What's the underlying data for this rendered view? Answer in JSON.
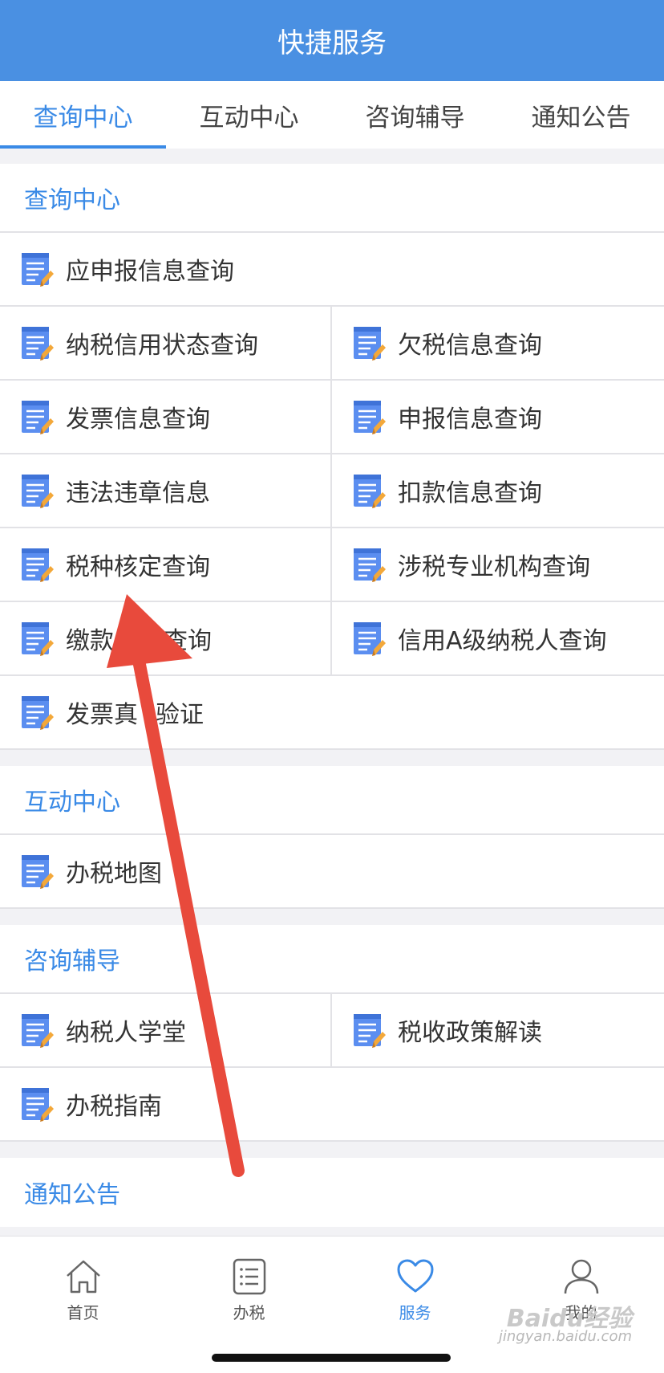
{
  "header": {
    "title": "快捷服务"
  },
  "tabs": [
    {
      "label": "查询中心",
      "active": true
    },
    {
      "label": "互动中心",
      "active": false
    },
    {
      "label": "咨询辅导",
      "active": false
    },
    {
      "label": "通知公告",
      "active": false
    }
  ],
  "sections": {
    "query": {
      "title": "查询中心",
      "items": [
        "应申报信息查询",
        "纳税信用状态查询",
        "欠税信息查询",
        "发票信息查询",
        "申报信息查询",
        "违法违章信息",
        "扣款信息查询",
        "税种核定查询",
        "涉税专业机构查询",
        "缴款",
        "查询",
        "信用A级纳税人查询",
        "发票真",
        "验证"
      ]
    },
    "interact": {
      "title": "互动中心",
      "items": [
        "办税地图"
      ]
    },
    "consult": {
      "title": "咨询辅导",
      "items": [
        "纳税人学堂",
        "税收政策解读",
        "办税指南"
      ]
    },
    "notice": {
      "title": "通知公告"
    }
  },
  "bottom_nav": [
    {
      "label": "首页",
      "icon": "home-icon"
    },
    {
      "label": "办税",
      "icon": "list-icon"
    },
    {
      "label": "服务",
      "icon": "heart-icon",
      "active": true
    },
    {
      "label": "我的",
      "icon": "user-icon"
    }
  ],
  "icons": {
    "item_icon": "document-pencil-icon"
  },
  "colors": {
    "primary": "#4a90e2",
    "accent": "#3a8ae6",
    "arrow": "#e84a3c"
  },
  "watermark": {
    "line1": "Baidu经验",
    "line2": "jingyan.baidu.com"
  }
}
